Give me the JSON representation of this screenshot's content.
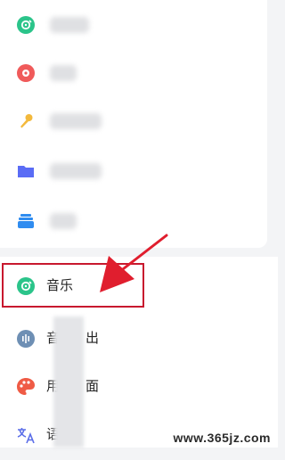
{
  "settings_list": {
    "items_blurred": [
      {
        "icon": "disc-icon",
        "color": "#2bc48a"
      },
      {
        "icon": "record-icon",
        "color": "#f05a5a"
      },
      {
        "icon": "microphone-icon",
        "color": "#f3b93c"
      },
      {
        "icon": "folder-icon",
        "color": "#5a6cf5"
      },
      {
        "icon": "stack-icon",
        "color": "#2f8cf0"
      }
    ],
    "music": {
      "label": "音乐",
      "icon": "disc-icon",
      "color": "#2bc48a"
    },
    "sound_output": {
      "label_start": "音",
      "label_end": "出",
      "icon": "sound-wave-icon",
      "color": "#6e8fb4"
    },
    "appearance": {
      "label_start": "用",
      "label_end": "面",
      "icon": "palette-icon",
      "color": "#ef5b45"
    },
    "language": {
      "label_start": "语",
      "icon": "translate-icon",
      "color": "#5b6ee8"
    }
  },
  "annotation": {
    "arrow_color": "#e01e2e",
    "box_color": "#c8182e"
  },
  "watermark": "www.365jz.com"
}
